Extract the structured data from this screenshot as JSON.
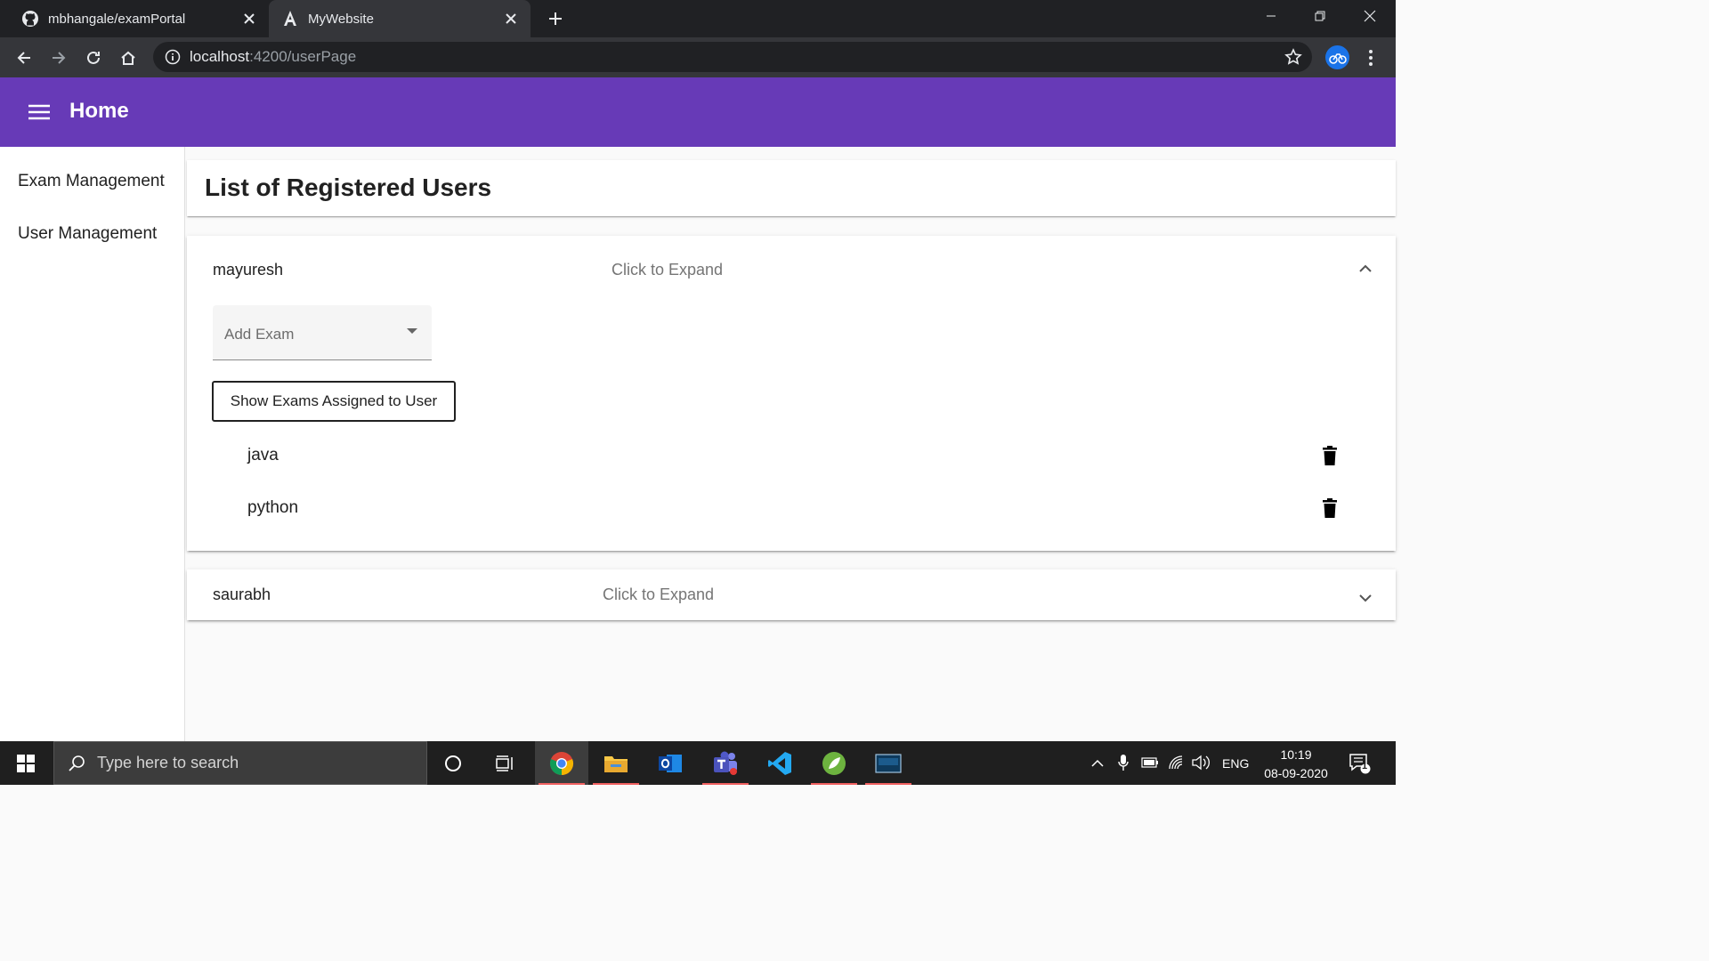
{
  "browser": {
    "tabs": [
      {
        "title": "mbhangale/examPortal",
        "icon": "github-icon"
      },
      {
        "title": "MyWebsite",
        "icon": "angular-icon"
      }
    ],
    "url_host": "localhost",
    "url_path": ":4200/userPage"
  },
  "app": {
    "title": "Home",
    "header_color": "#673ab7"
  },
  "sidebar": {
    "items": [
      {
        "label": "Exam Management"
      },
      {
        "label": "User Management"
      }
    ]
  },
  "main": {
    "heading": "List of Registered Users",
    "users": [
      {
        "name": "mayuresh",
        "description": "Click to Expand",
        "expanded": true,
        "select_placeholder": "Add Exam",
        "show_button": "Show Exams Assigned to User",
        "exams": [
          {
            "name": "java"
          },
          {
            "name": "python"
          }
        ]
      },
      {
        "name": "saurabh",
        "description": "Click to Expand",
        "expanded": false
      }
    ]
  },
  "taskbar": {
    "search_placeholder": "Type here to search",
    "apps": [
      "cortana-icon",
      "task-view-icon",
      "chrome-icon",
      "file-explorer-icon",
      "outlook-icon",
      "teams-icon",
      "vscode-icon",
      "spring-tools-icon",
      "mysql-workbench-icon"
    ],
    "language": "ENG",
    "time": "10:19",
    "date": "08-09-2020",
    "notification_count": "1"
  }
}
